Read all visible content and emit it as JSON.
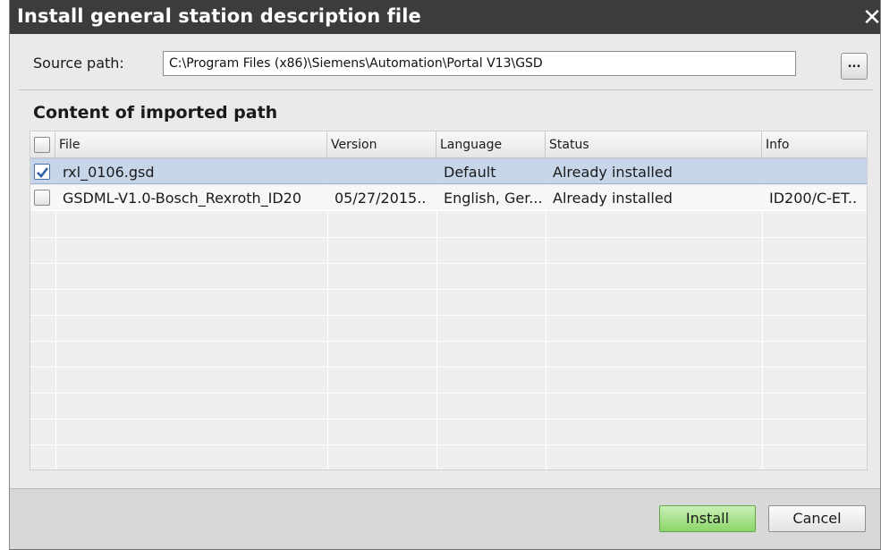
{
  "window": {
    "title": "Install general station description file",
    "close_glyph": "✕"
  },
  "source": {
    "label": "Source path:",
    "value": "C:\\Program Files (x86)\\Siemens\\Automation\\Portal V13\\GSD",
    "browse_label": "..."
  },
  "content": {
    "heading": "Content of imported path",
    "columns": [
      "File",
      "Version",
      "Language",
      "Status",
      "Info"
    ],
    "rows": [
      {
        "checked": true,
        "file": "rxl_0106.gsd",
        "version": "",
        "language": "Default",
        "status": "Already installed",
        "info": ""
      },
      {
        "checked": false,
        "file": "GSDML-V1.0-Bosch_Rexroth_ID20",
        "version": "05/27/2015..",
        "language": "English, Ger...",
        "status": "Already installed",
        "info": "ID200/C-ET.."
      }
    ]
  },
  "buttons": {
    "install": "Install",
    "cancel": "Cancel"
  },
  "icons": {
    "checkbox_checked": "checkmark-icon",
    "close": "close-icon"
  },
  "colors": {
    "titlebar": "#3c3c3c",
    "selected_row": "#c7d5e8",
    "install_button": "#8bd56a",
    "dialog_bg": "#eaeaea"
  }
}
